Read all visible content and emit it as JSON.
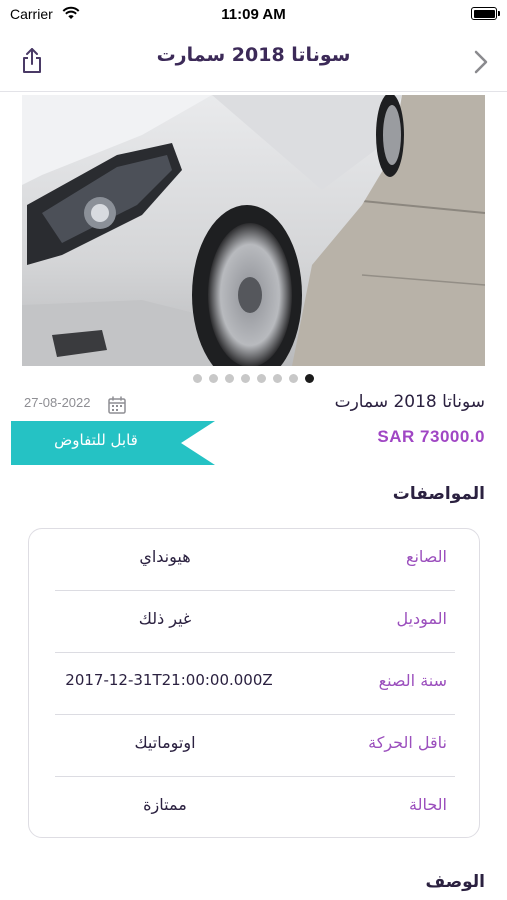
{
  "status_bar": {
    "carrier": "Carrier",
    "time": "11:09 AM"
  },
  "nav": {
    "title": "سوناتا 2018 سمارت",
    "share_icon": "share-icon",
    "back_icon": "chevron-right-icon"
  },
  "gallery": {
    "image": "silver sedan front wheel photo",
    "dots_count": 8,
    "active_index": 7
  },
  "listing": {
    "title": "سوناتا 2018 سمارت",
    "date": "27-08-2022",
    "negotiable_label": "قابل للتفاوض",
    "price": "SAR 73000.0"
  },
  "specs": {
    "heading": "المواصفات",
    "rows": [
      {
        "label": "الصانع",
        "value": "هيونداي"
      },
      {
        "label": "الموديل",
        "value": "غير ذلك"
      },
      {
        "label": "سنة الصنع",
        "value": "2017-12-31T21:00:00.000Z"
      },
      {
        "label": "ناقل الحركة",
        "value": "اوتوماتيك"
      },
      {
        "label": "الحالة",
        "value": "ممتازة"
      }
    ]
  },
  "description": {
    "heading": "الوصف"
  },
  "colors": {
    "accent_purple": "#a046c4",
    "badge_teal": "#25c2c4",
    "title_dark": "#3c2a58"
  }
}
